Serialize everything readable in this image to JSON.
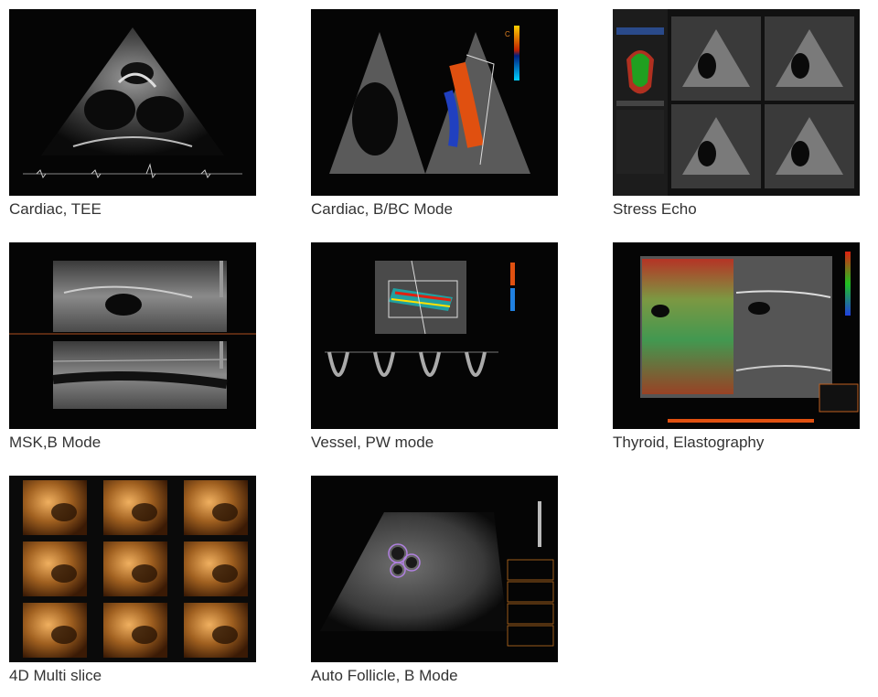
{
  "gallery": {
    "items": [
      {
        "caption": "Cardiac, TEE"
      },
      {
        "caption": "Cardiac, B/BC Mode"
      },
      {
        "caption": "Stress Echo"
      },
      {
        "caption": "MSK,B Mode"
      },
      {
        "caption": "Vessel, PW mode"
      },
      {
        "caption": "Thyroid, Elastography"
      },
      {
        "caption": "4D Multi slice"
      },
      {
        "caption": "Auto Follicle, B Mode"
      }
    ]
  }
}
